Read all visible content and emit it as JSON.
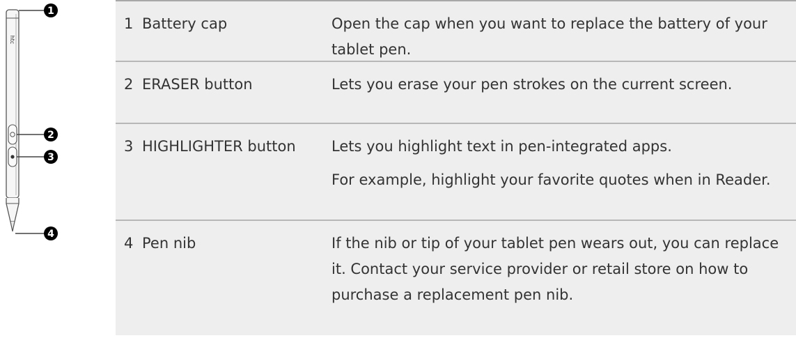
{
  "diagram": {
    "pen_brand_text": "htc",
    "callouts": [
      "1",
      "2",
      "3",
      "4"
    ]
  },
  "parts": [
    {
      "number": "1",
      "name": "Battery cap",
      "description": [
        "Open the cap when you want to replace the battery of your tablet pen."
      ]
    },
    {
      "number": "2",
      "name": "ERASER button",
      "description": [
        "Lets you erase your pen strokes on the current screen."
      ]
    },
    {
      "number": "3",
      "name": "HIGHLIGHTER button",
      "description": [
        "Lets you highlight text in pen-integrated apps.",
        "For example, highlight your favorite quotes when in Reader."
      ]
    },
    {
      "number": "4",
      "name": "Pen nib",
      "description": [
        "If the nib or tip of your tablet pen wears out, you can replace it. Contact your service provider or retail store on how to purchase a replacement pen nib."
      ]
    }
  ]
}
